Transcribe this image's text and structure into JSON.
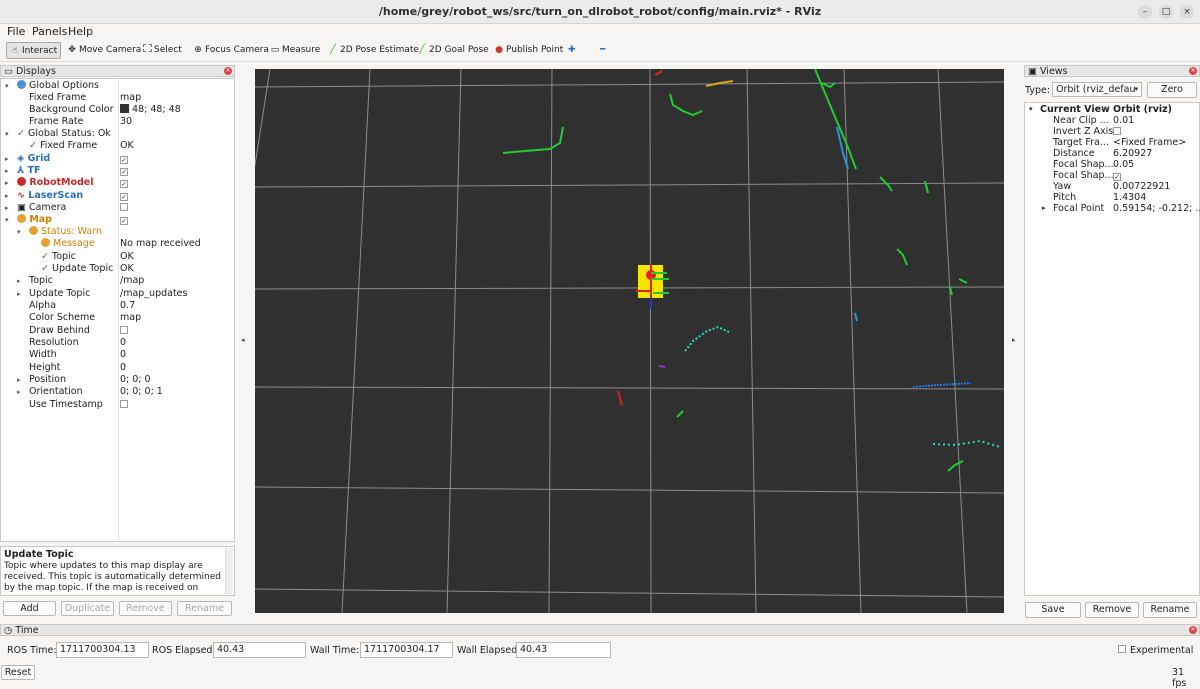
{
  "window": {
    "title": "/home/grey/robot_ws/src/turn_on_dlrobot_robot/config/main.rviz* - RViz",
    "minimize": "–",
    "maximize": "□",
    "close": "×"
  },
  "menu": {
    "file": "File",
    "panels": "Panels",
    "help": "Help"
  },
  "toolbar": {
    "interact": "Interact",
    "move_camera": "Move Camera",
    "select": "Select",
    "focus_camera": "Focus Camera",
    "measure": "Measure",
    "pose_estimate": "2D Pose Estimate",
    "goal_pose": "2D Goal Pose",
    "publish_point": "Publish Point"
  },
  "displays": {
    "header": "Displays",
    "tree": [
      {
        "label": "Global Options",
        "value": ""
      },
      {
        "label": "Fixed Frame",
        "value": "map"
      },
      {
        "label": "Background Color",
        "value": "48; 48; 48"
      },
      {
        "label": "Frame Rate",
        "value": "30"
      },
      {
        "label": "Global Status: Ok",
        "value": ""
      },
      {
        "label": "Fixed Frame",
        "value": "OK"
      },
      {
        "label": "Grid",
        "value": ""
      },
      {
        "label": "TF",
        "value": ""
      },
      {
        "label": "RobotModel",
        "value": ""
      },
      {
        "label": "LaserScan",
        "value": ""
      },
      {
        "label": "Camera",
        "value": ""
      },
      {
        "label": "Map",
        "value": ""
      },
      {
        "label": "Status: Warn",
        "value": ""
      },
      {
        "label": "Message",
        "value": "No map received"
      },
      {
        "label": "Topic",
        "value": "OK"
      },
      {
        "label": "Update Topic",
        "value": "OK"
      },
      {
        "label": "Topic",
        "value": "/map"
      },
      {
        "label": "Update Topic",
        "value": "/map_updates"
      },
      {
        "label": "Alpha",
        "value": "0.7"
      },
      {
        "label": "Color Scheme",
        "value": "map"
      },
      {
        "label": "Draw Behind",
        "value": ""
      },
      {
        "label": "Resolution",
        "value": "0"
      },
      {
        "label": "Width",
        "value": "0"
      },
      {
        "label": "Height",
        "value": "0"
      },
      {
        "label": "Position",
        "value": "0; 0; 0"
      },
      {
        "label": "Orientation",
        "value": "0; 0; 0; 1"
      },
      {
        "label": "Use Timestamp",
        "value": ""
      }
    ],
    "description_title": "Update Topic",
    "description_text": "Topic where updates to this map display are received. This topic is automatically determined by the map topic. If the map is received on",
    "buttons": {
      "add": "Add",
      "duplicate": "Duplicate",
      "remove": "Remove",
      "rename": "Rename"
    }
  },
  "views": {
    "header": "Views",
    "type_label": "Type:",
    "type_value": "Orbit (rviz_defau",
    "zero": "Zero",
    "current_view_label": "Current View",
    "current_view_value": "Orbit (rviz)",
    "props": [
      {
        "label": "Near Clip ...",
        "value": "0.01"
      },
      {
        "label": "Invert Z Axis",
        "value": ""
      },
      {
        "label": "Target Fra...",
        "value": "<Fixed Frame>"
      },
      {
        "label": "Distance",
        "value": "6.20927"
      },
      {
        "label": "Focal Shap...",
        "value": "0.05"
      },
      {
        "label": "Focal Shap...",
        "value": ""
      },
      {
        "label": "Yaw",
        "value": "0.00722921"
      },
      {
        "label": "Pitch",
        "value": "1.4304"
      },
      {
        "label": "Focal Point",
        "value": "0.59154; -0.212; ..."
      }
    ],
    "buttons": {
      "save": "Save",
      "remove": "Remove",
      "rename": "Rename"
    }
  },
  "time": {
    "header": "Time",
    "ros_time_label": "ROS Time:",
    "ros_time": "1711700304.13",
    "ros_elapsed_label": "ROS Elapsed:",
    "ros_elapsed": "40.43",
    "wall_time_label": "Wall Time:",
    "wall_time": "1711700304.17",
    "wall_elapsed_label": "Wall Elapsed:",
    "wall_elapsed": "40.43",
    "experimental": "Experimental",
    "reset": "Reset",
    "fps": "31 fps"
  },
  "colors": {
    "viewport_bg": "#303030",
    "grid": "#a0a0a0",
    "robot_body": "#f5e400",
    "robot_marker": "#e02020",
    "laser_green": "#22cc33",
    "laser_cyan": "#22ddbb"
  }
}
